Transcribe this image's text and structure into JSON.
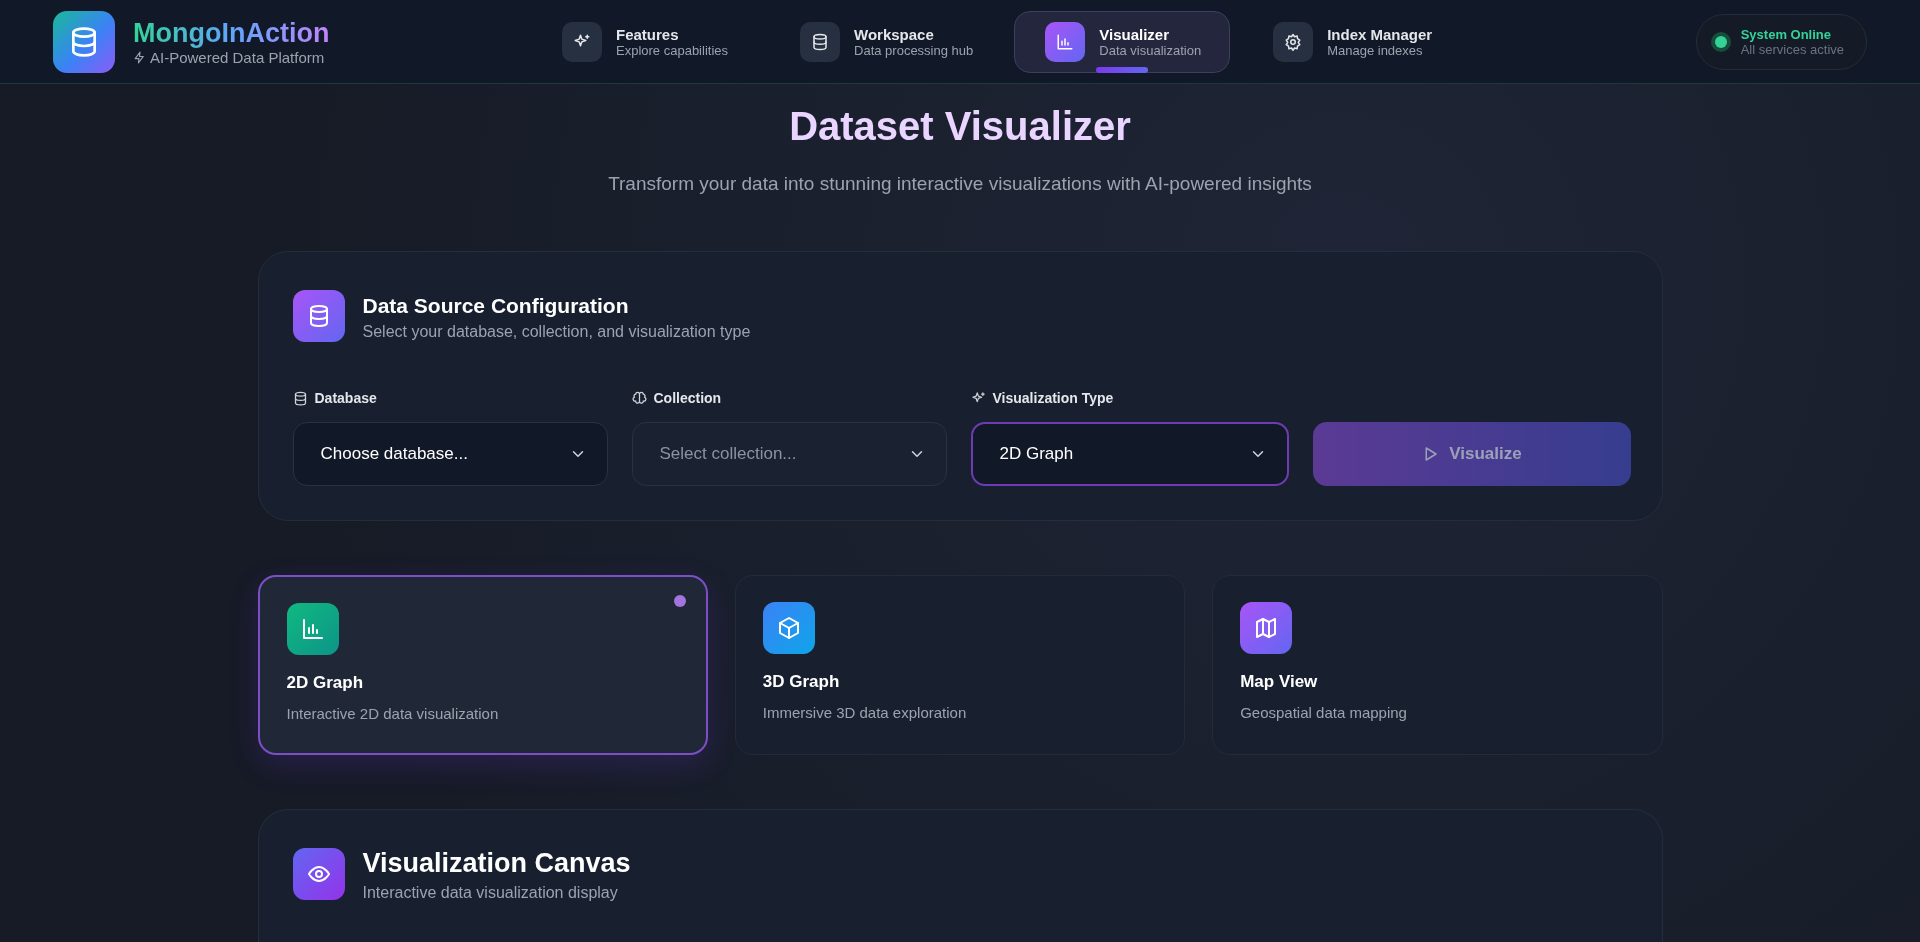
{
  "brand": {
    "name": "MongoInAction",
    "tagline": "AI-Powered Data Platform"
  },
  "nav": [
    {
      "label": "Features",
      "sublabel": "Explore capabilities",
      "selected": false
    },
    {
      "label": "Workspace",
      "sublabel": "Data processing hub",
      "selected": false
    },
    {
      "label": "Visualizer",
      "sublabel": "Data visualization",
      "selected": true
    },
    {
      "label": "Index Manager",
      "sublabel": "Manage indexes",
      "selected": false
    }
  ],
  "status": {
    "title": "System Online",
    "subtitle": "All services active",
    "online": true
  },
  "page": {
    "title": "Dataset Visualizer",
    "subtitle": "Transform your data into stunning interactive visualizations with AI-powered insights"
  },
  "config": {
    "title": "Data Source Configuration",
    "subtitle": "Select your database, collection, and visualization type",
    "fields": [
      {
        "label": "Database",
        "value": "Choose database...",
        "disabled": false,
        "focused": false
      },
      {
        "label": "Collection",
        "value": "Select collection...",
        "disabled": true,
        "focused": false
      },
      {
        "label": "Visualization Type",
        "value": "2D Graph",
        "disabled": false,
        "focused": true
      }
    ],
    "button": {
      "label": "Visualize",
      "disabled": true
    }
  },
  "viz_types": [
    {
      "title": "2D Graph",
      "description": "Interactive 2D data visualization",
      "selected": true
    },
    {
      "title": "3D Graph",
      "description": "Immersive 3D data exploration",
      "selected": false
    },
    {
      "title": "Map View",
      "description": "Geospatial data mapping",
      "selected": false
    }
  ],
  "canvas": {
    "title": "Visualization Canvas",
    "subtitle": "Interactive data visualization display"
  }
}
